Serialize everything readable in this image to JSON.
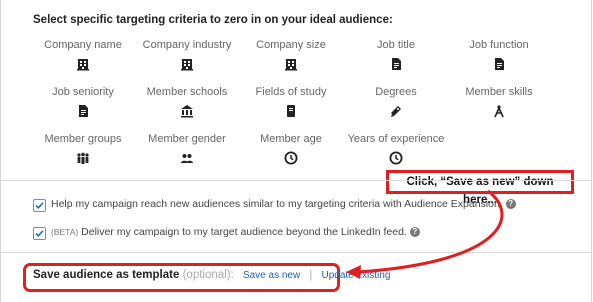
{
  "heading": "Select specific targeting criteria to zero in on your ideal audience:",
  "criteria": [
    {
      "label": "Company name",
      "icon": "building-icon"
    },
    {
      "label": "Company industry",
      "icon": "building-icon"
    },
    {
      "label": "Company size",
      "icon": "building-icon"
    },
    {
      "label": "Job title",
      "icon": "document-icon"
    },
    {
      "label": "Job function",
      "icon": "document-icon"
    },
    {
      "label": "Job seniority",
      "icon": "document-icon"
    },
    {
      "label": "Member schools",
      "icon": "institution-icon"
    },
    {
      "label": "Fields of study",
      "icon": "book-icon"
    },
    {
      "label": "Degrees",
      "icon": "diploma-icon"
    },
    {
      "label": "Member skills",
      "icon": "compass-icon"
    },
    {
      "label": "Member groups",
      "icon": "group-icon"
    },
    {
      "label": "Member gender",
      "icon": "people-icon"
    },
    {
      "label": "Member age",
      "icon": "clock-icon"
    },
    {
      "label": "Years of experience",
      "icon": "clock-icon"
    }
  ],
  "options": {
    "expansion": "Help my campaign reach new audiences similar to my targeting criteria with Audience Expansion.",
    "beta_tag": "(BETA)",
    "network": "Deliver my campaign to my target audience beyond the LinkedIn feed.",
    "help_glyph": "?"
  },
  "save": {
    "title": "Save audience as template",
    "optional": "(optional):",
    "save_as_new": "Save as new",
    "separator": "|",
    "update_existing": "Update existing"
  },
  "annotation": {
    "callout": "Click, “Save as new” down here...",
    "color": "#e02020"
  },
  "colors": {
    "link": "#1a65b2",
    "checkbox": "#6f8fb5"
  }
}
